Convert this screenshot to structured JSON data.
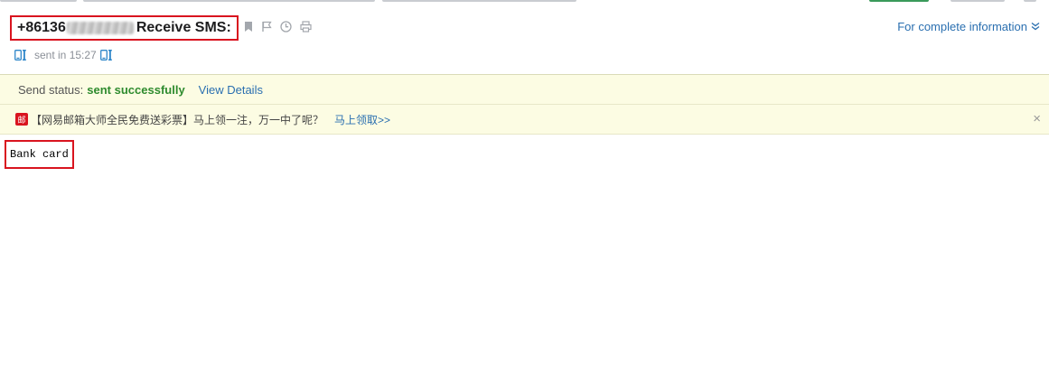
{
  "header": {
    "subject_prefix": "+86136",
    "subject_suffix": "Receive SMS:",
    "complete_info_label": "For complete information",
    "sent_text": "sent in 15:27"
  },
  "status": {
    "label": "Send status:",
    "value": "sent successfully",
    "view_details": "View Details"
  },
  "promo": {
    "icon_char": "邮",
    "text": "【网易邮箱大师全民免费送彩票】马上领一注，万一中了呢？",
    "link": "马上领取>>",
    "close": "×"
  },
  "message": {
    "body": "Bank card"
  },
  "colors": {
    "accent_red": "#d9141f",
    "link_blue": "#2a6fb0",
    "success_green": "#2e8b2e",
    "notice_bg": "#fcfce3"
  },
  "icons": [
    "bookmark-icon",
    "flag-icon",
    "clock-icon",
    "print-icon",
    "chevron-down-icon",
    "phone-icon",
    "close-icon",
    "mail-master-icon"
  ]
}
